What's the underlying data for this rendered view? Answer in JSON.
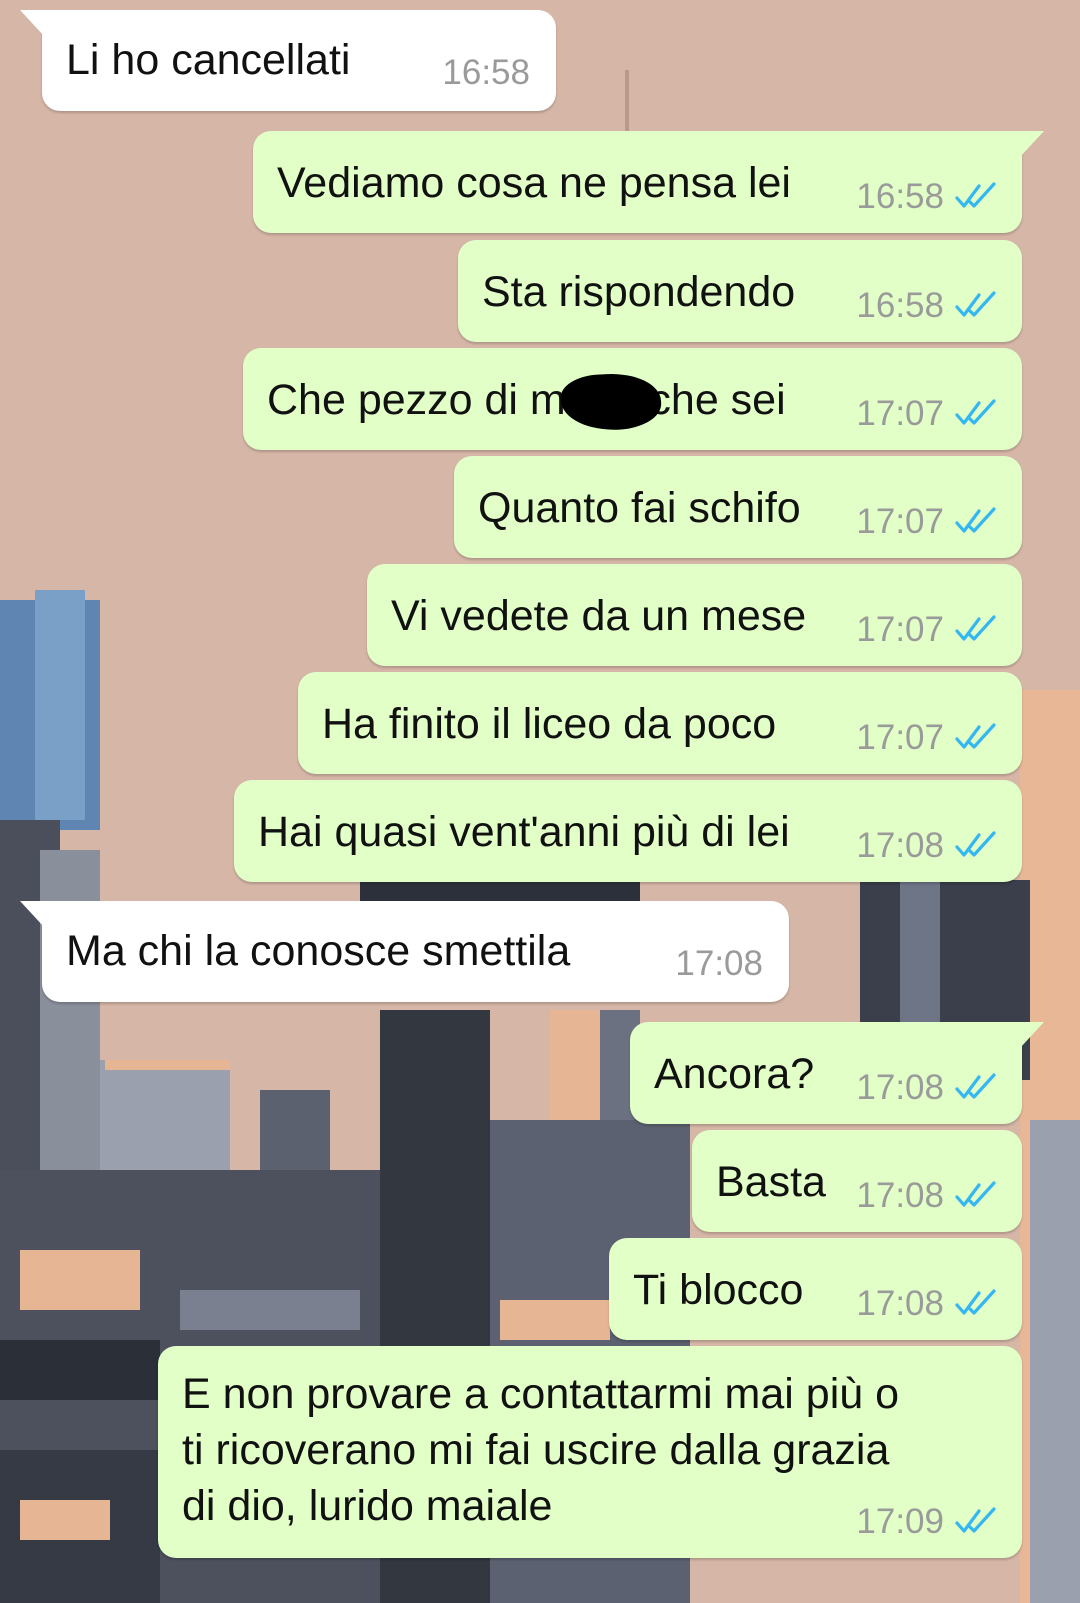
{
  "theme": {
    "outgoing_bubble": "#e1ffc7",
    "incoming_bubble": "#ffffff",
    "timestamp_color": "#9a9a9a",
    "read_tick_color": "#34b7f1",
    "wallpaper": "#d5b6a7"
  },
  "messages": [
    {
      "direction": "incoming",
      "text": "Li ho cancellati",
      "time": "16:58",
      "status": ""
    },
    {
      "direction": "outgoing",
      "text": "Vediamo cosa ne pensa lei",
      "time": "16:58",
      "status": "read-double-tick-icon"
    },
    {
      "direction": "outgoing",
      "text": "Sta rispondendo",
      "time": "16:58",
      "status": "read-double-tick-icon"
    },
    {
      "direction": "outgoing",
      "text": "Che pezzo di m    a che sei",
      "time": "17:07",
      "status": "read-double-tick-icon",
      "redacted": true
    },
    {
      "direction": "outgoing",
      "text": "Quanto fai schifo",
      "time": "17:07",
      "status": "read-double-tick-icon"
    },
    {
      "direction": "outgoing",
      "text": "Vi vedete da un mese",
      "time": "17:07",
      "status": "read-double-tick-icon"
    },
    {
      "direction": "outgoing",
      "text": "Ha finito il liceo da poco",
      "time": "17:07",
      "status": "read-double-tick-icon"
    },
    {
      "direction": "outgoing",
      "text": "Hai quasi vent'anni più di lei",
      "time": "17:08",
      "status": "read-double-tick-icon"
    },
    {
      "direction": "incoming",
      "text": "Ma chi la conosce smettila",
      "time": "17:08",
      "status": ""
    },
    {
      "direction": "outgoing",
      "text": "Ancora?",
      "time": "17:08",
      "status": "read-double-tick-icon"
    },
    {
      "direction": "outgoing",
      "text": "Basta",
      "time": "17:08",
      "status": "read-double-tick-icon"
    },
    {
      "direction": "outgoing",
      "text": "Ti blocco",
      "time": "17:08",
      "status": "read-double-tick-icon"
    },
    {
      "direction": "outgoing",
      "text": "E non provare a contattarmi mai più o\nti ricoverano mi fai uscire dalla grazia\ndi dio, lurido maiale",
      "time": "17:09",
      "status": "read-double-tick-icon"
    }
  ]
}
